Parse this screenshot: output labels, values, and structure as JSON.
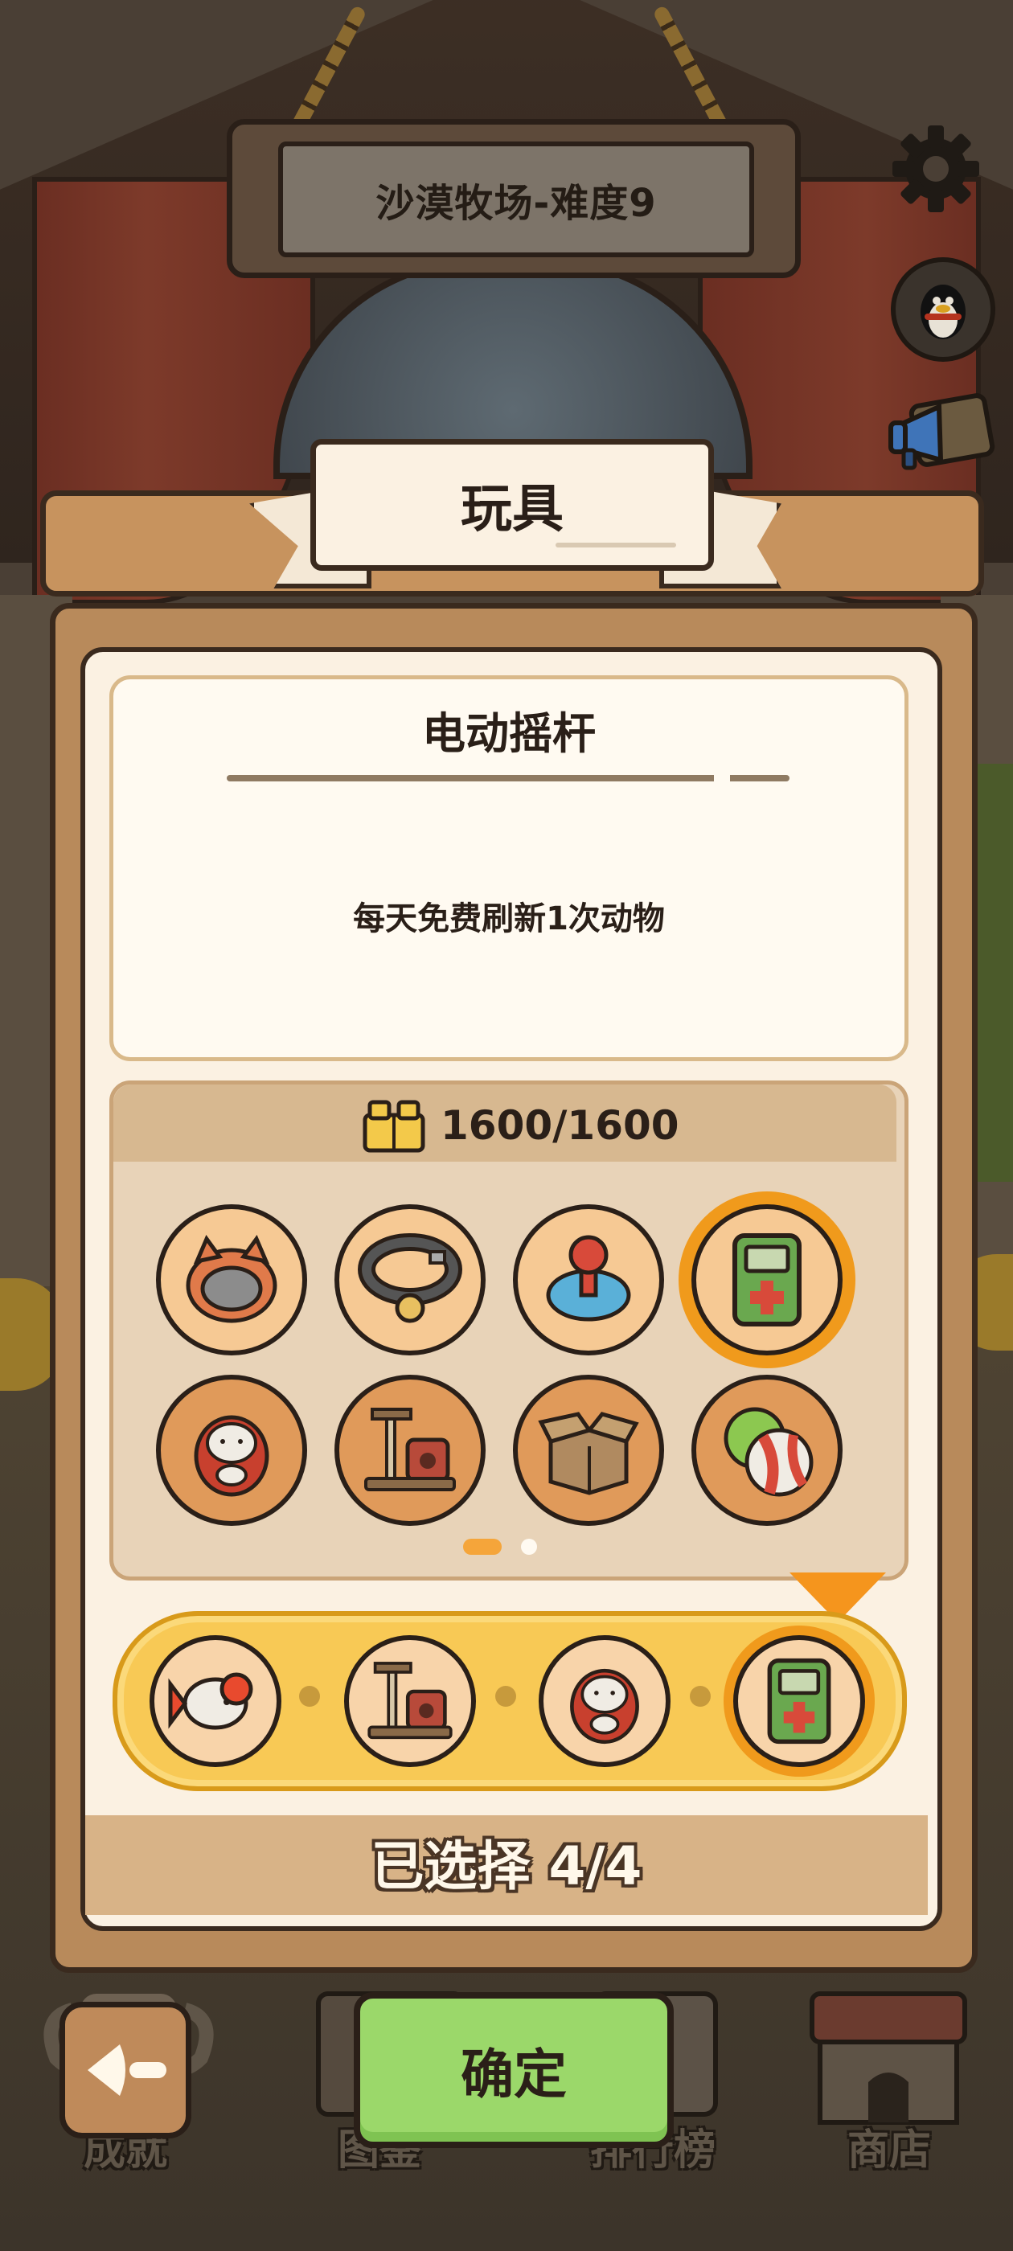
{
  "header": {
    "level_title": "沙漠牧场-难度9"
  },
  "modal": {
    "title": "玩具",
    "item_name": "电动摇杆",
    "item_desc": "每天免费刷新1次动物",
    "capacity": "1600/1600",
    "grid_items": [
      {
        "icon": "cat-bed-icon"
      },
      {
        "icon": "collar-icon"
      },
      {
        "icon": "joystick-toy-icon"
      },
      {
        "icon": "handheld-game-icon",
        "selected": true
      },
      {
        "icon": "cat-doll-icon"
      },
      {
        "icon": "cat-tree-icon"
      },
      {
        "icon": "cardboard-box-icon"
      },
      {
        "icon": "beach-ball-icon"
      }
    ],
    "page_index": 1,
    "page_count": 2,
    "selected_items": [
      {
        "icon": "goldfish-icon"
      },
      {
        "icon": "cat-tree-icon"
      },
      {
        "icon": "cat-doll-icon"
      },
      {
        "icon": "handheld-game-icon"
      }
    ],
    "selected_count_text": "已选择 4/4",
    "confirm_label": "确定"
  },
  "bottom_nav": {
    "items": [
      {
        "label": "成就",
        "icon": "trophy-icon"
      },
      {
        "label": "图鉴",
        "icon": "book-icon"
      },
      {
        "label": "排行榜",
        "icon": "scroll-icon"
      },
      {
        "label": "商店",
        "icon": "shop-icon"
      }
    ]
  },
  "colors": {
    "accent_orange": "#f09a1c",
    "confirm_green": "#9bd86a",
    "panel_cream": "#fbf1e2",
    "wood": "#b88a5b"
  }
}
